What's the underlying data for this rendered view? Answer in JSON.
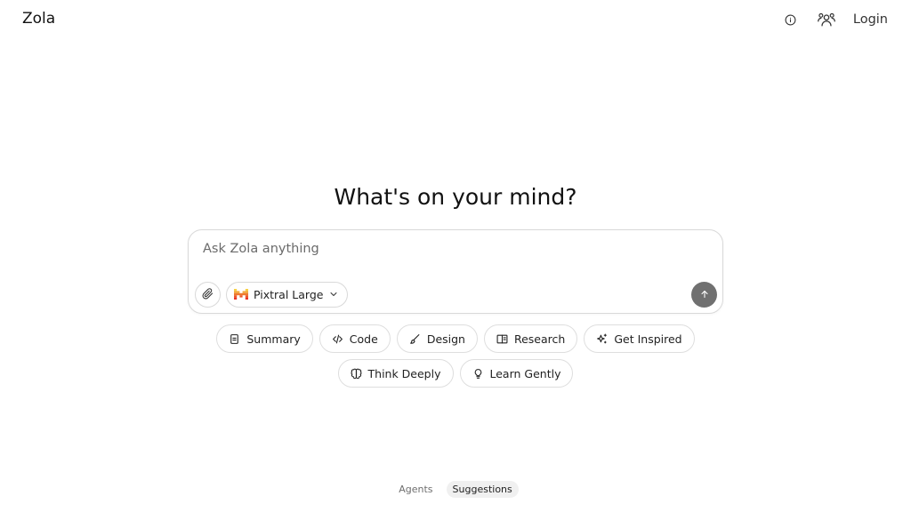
{
  "header": {
    "app_title": "Zola",
    "login_label": "Login",
    "icons": {
      "info": "info-icon",
      "users": "users-icon"
    }
  },
  "main": {
    "heading": "What's on your mind?",
    "prompt": {
      "placeholder": "Ask Zola anything",
      "value": "",
      "attach_icon": "paperclip-icon",
      "model": {
        "name": "Pixtral Large",
        "logo_icon": "mistral-logo-icon",
        "chevron_icon": "chevron-down-icon"
      },
      "send_icon": "arrow-up-icon"
    },
    "suggestions_row1": [
      {
        "label": "Summary",
        "icon": "note-icon"
      },
      {
        "label": "Code",
        "icon": "code-icon"
      },
      {
        "label": "Design",
        "icon": "brush-icon"
      },
      {
        "label": "Research",
        "icon": "book-icon"
      },
      {
        "label": "Get Inspired",
        "icon": "sparkles-icon"
      }
    ],
    "suggestions_row2": [
      {
        "label": "Think Deeply",
        "icon": "brain-icon"
      },
      {
        "label": "Learn Gently",
        "icon": "lightbulb-icon"
      }
    ]
  },
  "footer": {
    "tabs": [
      {
        "label": "Agents",
        "active": false
      },
      {
        "label": "Suggestions",
        "active": true
      }
    ]
  },
  "colors": {
    "send_button": "#707070",
    "border": "#d9d9d9",
    "active_tab_bg": "#f0f0f0",
    "mistral_logo": [
      "#f7d046",
      "#f2a73b",
      "#ee792f",
      "#eb5829",
      "#ea3326"
    ]
  }
}
